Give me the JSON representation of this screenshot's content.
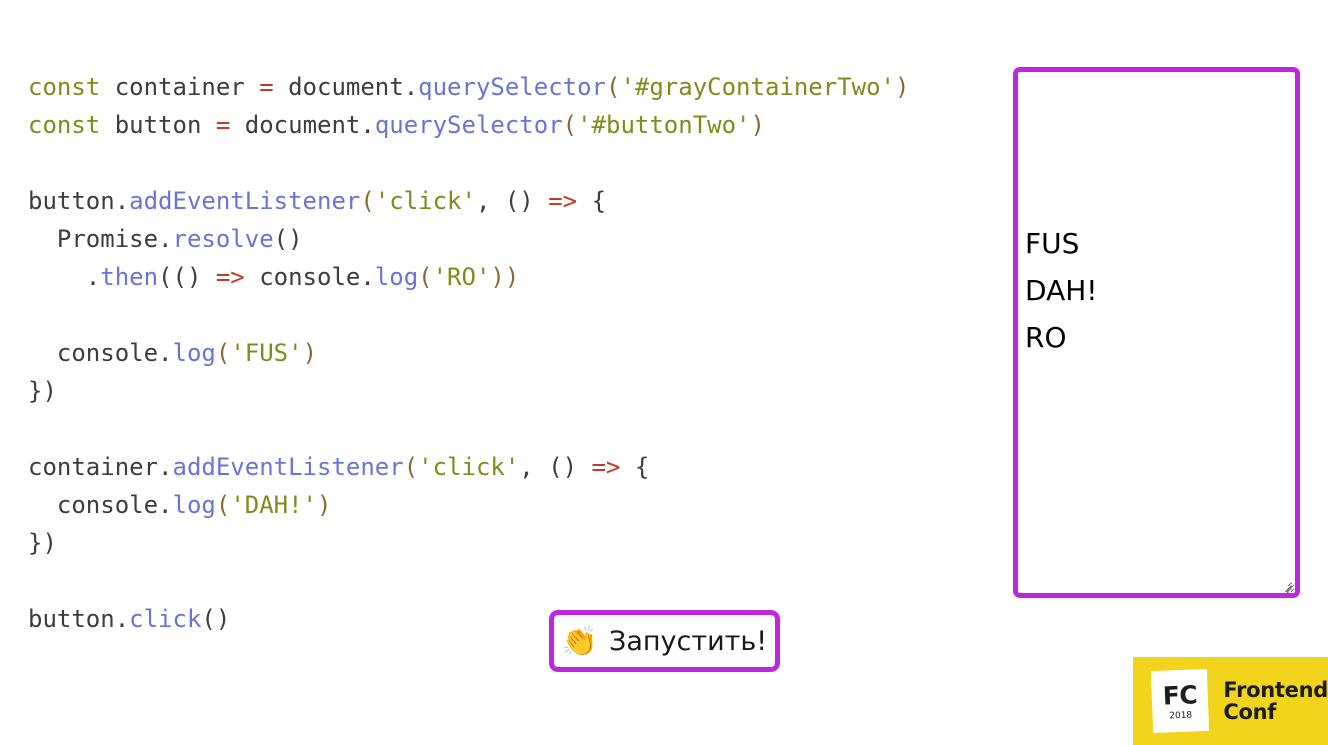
{
  "slide": {
    "background_color": "#ffffff",
    "accent_purple": "#bf26e0",
    "logo_yellow": "#f2d41c"
  },
  "code": {
    "language": "javascript",
    "lines": [
      [
        {
          "t": "const ",
          "c": "tk-keyword"
        },
        {
          "t": "container ",
          "c": "tk-plain"
        },
        {
          "t": "= ",
          "c": "tk-operator"
        },
        {
          "t": "document.",
          "c": "tk-plain"
        },
        {
          "t": "querySelector",
          "c": "tk-method"
        },
        {
          "t": "(",
          "c": "tk-punct"
        },
        {
          "t": "'#grayContainerTwo'",
          "c": "tk-string"
        },
        {
          "t": ")",
          "c": "tk-punct"
        }
      ],
      [
        {
          "t": "const ",
          "c": "tk-keyword"
        },
        {
          "t": "button ",
          "c": "tk-plain"
        },
        {
          "t": "= ",
          "c": "tk-operator"
        },
        {
          "t": "document.",
          "c": "tk-plain"
        },
        {
          "t": "querySelector",
          "c": "tk-method"
        },
        {
          "t": "(",
          "c": "tk-punct"
        },
        {
          "t": "'#buttonTwo'",
          "c": "tk-string"
        },
        {
          "t": ")",
          "c": "tk-punct"
        }
      ],
      [],
      [
        {
          "t": "button.",
          "c": "tk-plain"
        },
        {
          "t": "addEventListener",
          "c": "tk-method"
        },
        {
          "t": "(",
          "c": "tk-punct"
        },
        {
          "t": "'click'",
          "c": "tk-string"
        },
        {
          "t": ", () ",
          "c": "tk-plain"
        },
        {
          "t": "=> ",
          "c": "tk-operator"
        },
        {
          "t": "{",
          "c": "tk-brace"
        }
      ],
      [
        {
          "t": "  Promise.",
          "c": "tk-plain"
        },
        {
          "t": "resolve",
          "c": "tk-method"
        },
        {
          "t": "()",
          "c": "tk-plain"
        }
      ],
      [
        {
          "t": "    .",
          "c": "tk-plain"
        },
        {
          "t": "then",
          "c": "tk-method"
        },
        {
          "t": "(() ",
          "c": "tk-plain"
        },
        {
          "t": "=> ",
          "c": "tk-operator"
        },
        {
          "t": "console.",
          "c": "tk-plain"
        },
        {
          "t": "log",
          "c": "tk-method"
        },
        {
          "t": "(",
          "c": "tk-punct"
        },
        {
          "t": "'RO'",
          "c": "tk-string"
        },
        {
          "t": "))",
          "c": "tk-punct"
        }
      ],
      [],
      [
        {
          "t": "  console.",
          "c": "tk-plain"
        },
        {
          "t": "log",
          "c": "tk-method"
        },
        {
          "t": "(",
          "c": "tk-punct"
        },
        {
          "t": "'FUS'",
          "c": "tk-string"
        },
        {
          "t": ")",
          "c": "tk-punct"
        }
      ],
      [
        {
          "t": "})",
          "c": "tk-brace"
        }
      ],
      [],
      [
        {
          "t": "container.",
          "c": "tk-plain"
        },
        {
          "t": "addEventListener",
          "c": "tk-method"
        },
        {
          "t": "(",
          "c": "tk-punct"
        },
        {
          "t": "'click'",
          "c": "tk-string"
        },
        {
          "t": ", () ",
          "c": "tk-plain"
        },
        {
          "t": "=> ",
          "c": "tk-operator"
        },
        {
          "t": "{",
          "c": "tk-brace"
        }
      ],
      [
        {
          "t": "  console.",
          "c": "tk-plain"
        },
        {
          "t": "log",
          "c": "tk-method"
        },
        {
          "t": "(",
          "c": "tk-punct"
        },
        {
          "t": "'DAH!'",
          "c": "tk-string"
        },
        {
          "t": ")",
          "c": "tk-punct"
        }
      ],
      [
        {
          "t": "})",
          "c": "tk-brace"
        }
      ],
      [],
      [
        {
          "t": "button.",
          "c": "tk-plain"
        },
        {
          "t": "click",
          "c": "tk-method"
        },
        {
          "t": "()",
          "c": "tk-plain"
        }
      ]
    ]
  },
  "run_button": {
    "emoji": "👏",
    "emoji_name": "clapping-hands-emoji",
    "label": "Запустить!"
  },
  "output": {
    "lines": [
      "FUS",
      "DAH!",
      "RO"
    ],
    "resize_handle": "resize-grip"
  },
  "logo": {
    "mark_text": "FC",
    "mark_year": "2018",
    "word_line1": "Frontend",
    "word_line2": "Conf"
  }
}
